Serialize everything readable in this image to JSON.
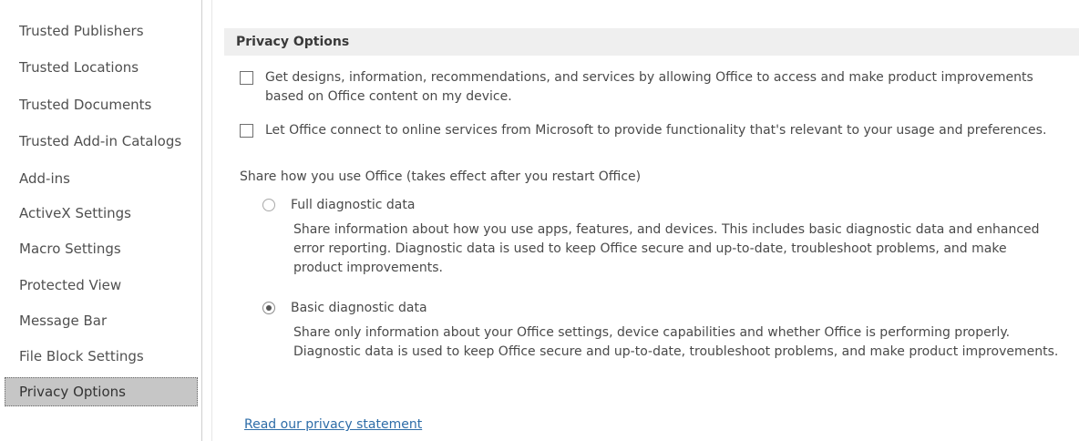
{
  "sidebar": {
    "items": [
      {
        "label": "Trusted Publishers"
      },
      {
        "label": "Trusted Locations"
      },
      {
        "label": "Trusted Documents"
      },
      {
        "label": "Trusted Add-in Catalogs"
      },
      {
        "label": "Add-ins"
      },
      {
        "label": "ActiveX Settings"
      },
      {
        "label": "Macro Settings"
      },
      {
        "label": "Protected View"
      },
      {
        "label": "Message Bar"
      },
      {
        "label": "File Block Settings"
      },
      {
        "label": "Privacy Options",
        "selected": true
      }
    ]
  },
  "main": {
    "section_title": "Privacy Options",
    "checkboxes": [
      {
        "label": "Get designs, information, recommendations, and services by allowing Office to access and make product improvements based on Office content on my device.",
        "checked": false
      },
      {
        "label": "Let Office connect to online services from Microsoft to provide functionality that's relevant to your usage and preferences.",
        "checked": false
      }
    ],
    "share_label": "Share how you use Office (takes effect after you restart Office)",
    "radios": [
      {
        "label": "Full diagnostic data",
        "description": "Share information about how you use apps, features, and devices. This includes basic diagnostic data and enhanced error reporting. Diagnostic data is used to keep Office secure and up-to-date, troubleshoot problems, and make product improvements.",
        "selected": false
      },
      {
        "label": "Basic diagnostic data",
        "description": "Share only information about your Office settings, device capabilities and whether Office is performing properly. Diagnostic data is used to keep Office secure and up-to-date, troubleshoot problems, and make product improvements.",
        "selected": true
      }
    ],
    "privacy_link": "Read our privacy statement"
  },
  "colors": {
    "selected_item_bg": "#c6c6c6",
    "section_header_bg": "#efefef",
    "link": "#2e6da8"
  }
}
